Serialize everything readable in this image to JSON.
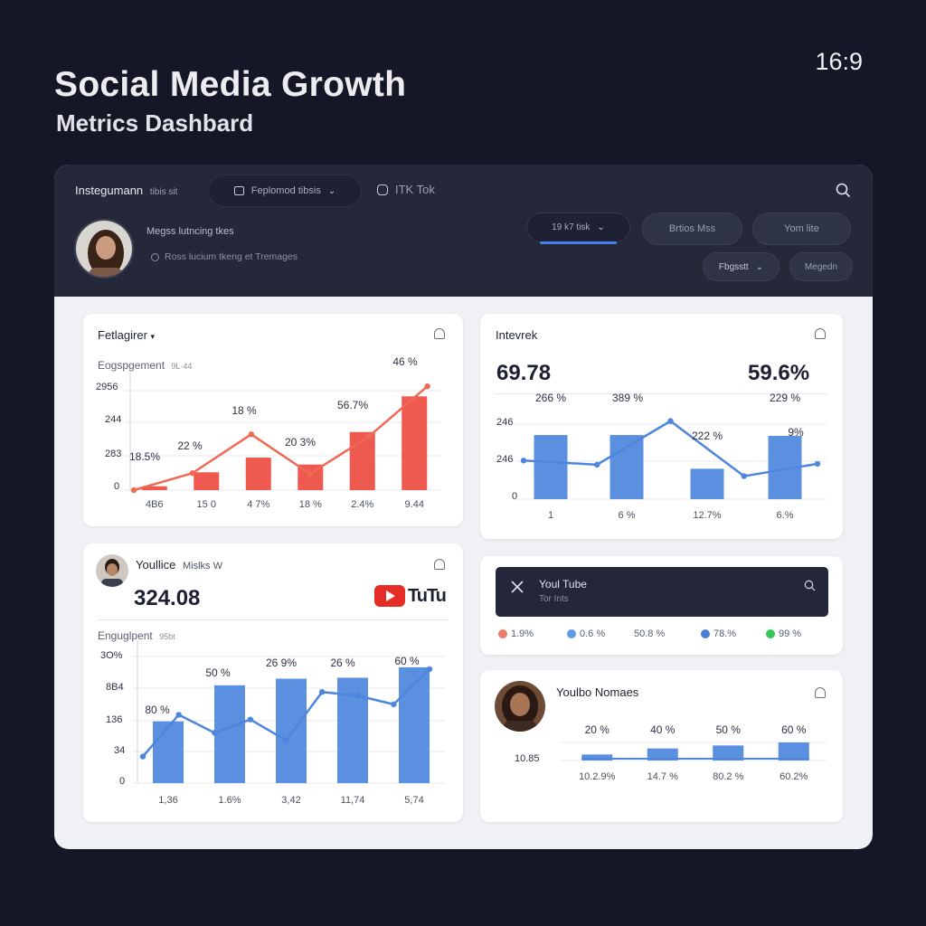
{
  "header": {
    "title": "Social Media Growth",
    "subtitle": "Metrics Dashbard",
    "ratio": "16:9"
  },
  "topbar": {
    "brand": "Instegumann",
    "brand_sub": "tibis sit",
    "dropdown_label": "Feplomod tibsis",
    "platform_label": "ITK Tok",
    "profile_name": "Megss lutncing tkes",
    "profile_meta": "Ross lucium tkeng et Tremages",
    "filter_label": "19 k7 tisk",
    "pill_1": "Brtios Mss",
    "pill_2": "Yom lite",
    "pill_3": "Fbgsstt",
    "pill_4": "Megedn"
  },
  "colors": {
    "accent_red": "#ee5a50",
    "accent_blue": "#5b8fdf",
    "dark": "#252839"
  },
  "cards": {
    "instagram": {
      "title": "Fetlagirer",
      "metric_label": "Eogspgement",
      "metric_sub": "9L·44",
      "y_ticks": [
        "2956",
        "244",
        "283",
        "0"
      ]
    },
    "intevrek": {
      "title": "Intevrek",
      "value_left": "69.78",
      "value_right": "59.6%",
      "y_ticks": [
        "246",
        "246",
        "0"
      ]
    },
    "youtube_metrics": {
      "title": "Youllice",
      "title_sub": "Mislks W",
      "value": "324.08",
      "logo_text": "TuTu",
      "metric_label": "Enguglpent",
      "metric_sub": "95bt",
      "y_ticks": [
        "3O%",
        "8B4",
        "136",
        "34",
        "0"
      ]
    },
    "youtube_dark": {
      "title": "Youl Tube",
      "subtitle": "Tor Ints",
      "stats": [
        "1.9%",
        "0.6 %",
        "50.8 %",
        "78.%",
        "99 %"
      ]
    },
    "youtube_nomaes": {
      "title": "Youlbo Nomaes",
      "y_tick": "10.85"
    }
  },
  "chart_data": [
    {
      "type": "bar",
      "name_ref": "instagram",
      "categories": [
        "4B6",
        "15 0",
        "4 7%",
        "18 %",
        "2.4%",
        "9.44"
      ],
      "values": [
        5,
        23,
        42,
        33,
        75,
        121
      ],
      "line": [
        0,
        22,
        72,
        21,
        69,
        134
      ],
      "data_labels": [
        "18.5%",
        "22 %",
        "18 %",
        "20 3%",
        "56.7%",
        "46 %"
      ],
      "ylim": [
        0,
        140
      ]
    },
    {
      "type": "bar",
      "name_ref": "intevrek",
      "categories": [
        "1",
        "6 %",
        "12.7%",
        "6.%"
      ],
      "values": [
        78,
        78,
        37,
        77
      ],
      "line": [
        47,
        42,
        95,
        28,
        43
      ],
      "data_labels": [
        "266 %",
        "389 %",
        "222 %",
        "229 %",
        "9%"
      ],
      "ylim": [
        0,
        110
      ]
    },
    {
      "type": "bar",
      "name_ref": "youtube_metrics",
      "categories": [
        "1,36",
        "1.6%",
        "3,42",
        "11,74",
        "5,74"
      ],
      "values": [
        65,
        103,
        110,
        111,
        122
      ],
      "line": [
        28,
        72,
        53,
        67,
        45,
        96,
        92,
        83,
        120
      ],
      "data_labels": [
        "80 %",
        "50 %",
        "26 9%",
        "26 %",
        "60 %"
      ],
      "ylim": [
        0,
        140
      ]
    },
    {
      "type": "bar",
      "name_ref": "youtube_nomaes",
      "categories": [
        "10.2.9%",
        "14.7 %",
        "80.2 %",
        "60.2%"
      ],
      "values": [
        20,
        40,
        50,
        60
      ],
      "data_labels": [
        "20 %",
        "40 %",
        "50 %",
        "60 %"
      ],
      "ylim": [
        0,
        60
      ]
    }
  ]
}
